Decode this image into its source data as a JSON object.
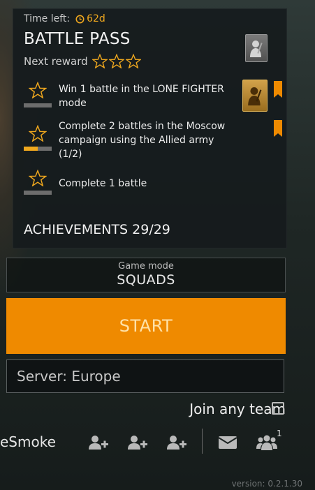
{
  "battle_pass": {
    "time_left_label": "Time left:",
    "time_left_value": "62d",
    "title": "BATTLE PASS",
    "next_reward_label": "Next reward",
    "tasks": [
      {
        "text": "Win 1 battle in the LONE FIGHTER mode",
        "progress": 0,
        "has_reward": true,
        "bookmarked": true
      },
      {
        "text": "Complete 2 battles in the Moscow campaign using the Allied army (1/2)",
        "progress": 0.5,
        "has_reward": false,
        "bookmarked": true
      },
      {
        "text": "Complete 1 battle",
        "progress": 0,
        "has_reward": false,
        "bookmarked": false
      }
    ]
  },
  "achievements": {
    "label": "ACHIEVEMENTS 29/29"
  },
  "game_mode": {
    "label": "Game mode",
    "value": "SQUADS"
  },
  "start_button": {
    "label": "START"
  },
  "server": {
    "value": "Server: Europe"
  },
  "join_any_team": {
    "label": "Join any team",
    "checked": false
  },
  "bottom_bar": {
    "player_name": "eSmoke",
    "friends_count": "1"
  },
  "version": "version: 0.2.1.30",
  "colors": {
    "accent": "#ef8a00",
    "star": "#f0a81e",
    "panel": "#161b1d"
  },
  "icons": [
    "clock-icon",
    "star-icon",
    "soldier-badge-icon",
    "bookmark-icon",
    "add-friend-icon",
    "mail-icon",
    "friends-icon"
  ]
}
